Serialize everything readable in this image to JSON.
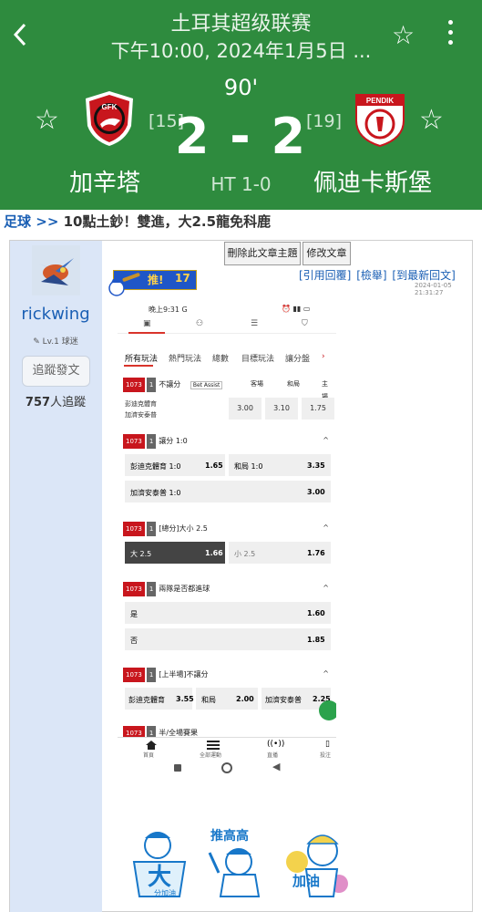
{
  "match": {
    "league": "土耳其超级联赛",
    "datetime": "下午10:00, 2024年1月5日 ...",
    "minute": "90'",
    "home": {
      "name": "加辛塔",
      "rank": "[15]",
      "logo_text": "GFK"
    },
    "away": {
      "name": "佩迪卡斯堡",
      "rank": "[19]",
      "logo_text": "PENDIK"
    },
    "score": "2 - 2",
    "halftime": "HT 1-0"
  },
  "breadcrumb": {
    "category": "足球",
    "separator": ">>",
    "title": "10點土鈔！雙進，大2.5龍免科鹿"
  },
  "author": {
    "username": "rickwing",
    "level": "Lv.1 球迷",
    "follow_label": "追蹤發文",
    "followers_count": "757",
    "followers_suffix": "人追蹤"
  },
  "post": {
    "delete_label": "刪除此文章主題",
    "edit_label": "修改文章",
    "push_label": "推!",
    "push_count": "17",
    "quote_label": "[引用回覆]",
    "report_label": "[檢舉]",
    "latest_label": "[到最新回文]",
    "timestamp": "2024-01-05 21:31:27"
  },
  "phone": {
    "status_time": "晚上9:31 G",
    "categories": [
      "所有玩法",
      "熱門玩法",
      "總數",
      "目標玩法",
      "讓分盤"
    ],
    "match_no": "1073",
    "match_sub": "1",
    "market1": {
      "title": "不讓分",
      "assist": "Bet Assist",
      "headers": [
        "客場",
        "和局",
        "主場"
      ],
      "teams": [
        "彭迪克體育",
        "加濟安泰普"
      ],
      "odds": [
        "3.00",
        "3.10",
        "1.75"
      ]
    },
    "market2": {
      "title": "讓分 1:0",
      "cells": [
        {
          "label": "彭迪克體育 1:0",
          "odd": "1.65"
        },
        {
          "label": "和局 1:0",
          "odd": "3.35"
        },
        {
          "label": "加濟安泰普 1:0",
          "odd": "3.00"
        }
      ]
    },
    "market3": {
      "title": "[總分]大小 2.5",
      "cells": [
        {
          "label": "大 2.5",
          "odd": "1.66"
        },
        {
          "label": "小 2.5",
          "odd": "1.76"
        }
      ]
    },
    "market4": {
      "title": "兩隊是否都進球",
      "cells": [
        {
          "label": "是",
          "odd": "1.60"
        },
        {
          "label": "否",
          "odd": "1.85"
        }
      ]
    },
    "market5": {
      "title": "[上半場]不讓分",
      "cells": [
        {
          "label": "彭迪克體育",
          "odd": "3.55"
        },
        {
          "label": "和局",
          "odd": "2.00"
        },
        {
          "label": "加濟安泰普",
          "odd": "2.25"
        }
      ]
    },
    "market6": {
      "title": "半/全場賽果"
    },
    "bottom_nav": [
      "首頁",
      "全部運動",
      "直播",
      "投注"
    ]
  },
  "stickers": [
    {
      "text": "大",
      "sub": "分加油"
    },
    {
      "text": "推高高",
      "sub": ""
    },
    {
      "text": "加油",
      "sub": ""
    }
  ],
  "colors": {
    "header_green": "#2e8b3e",
    "link_blue": "#1a5fb4",
    "side_blue": "#dbe6f7",
    "odds_red": "#c8161d"
  }
}
